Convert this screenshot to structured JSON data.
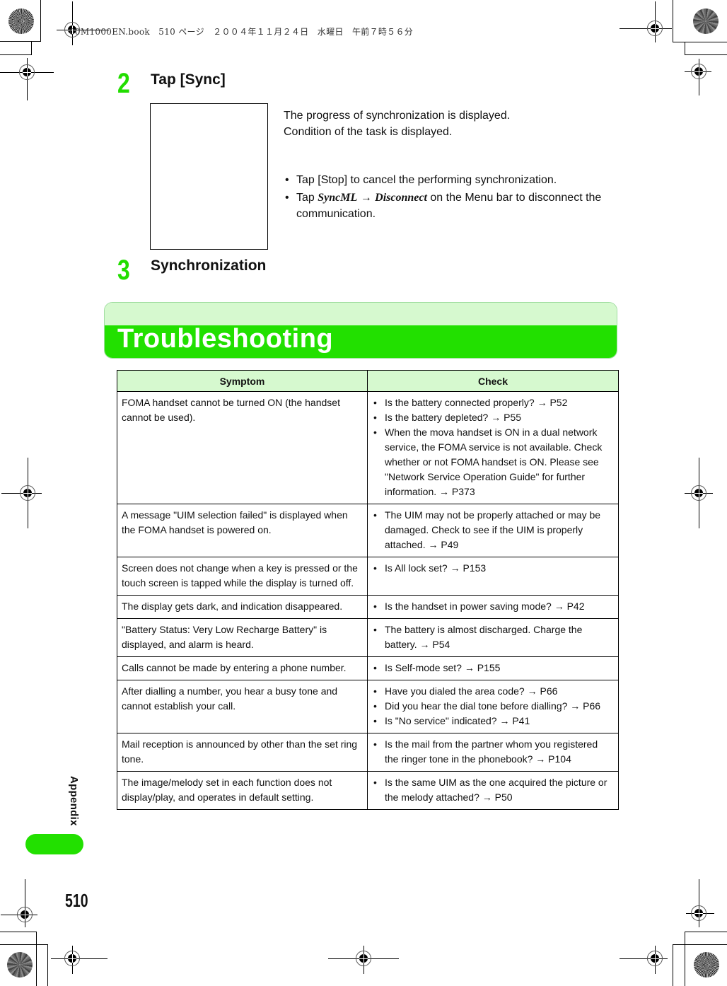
{
  "print_header": "00M1000EN.book　510 ページ　２００４年１１月２４日　水曜日　午前７時５６分",
  "steps": [
    {
      "number": "2",
      "title": "Tap [Sync]",
      "description": [
        "The progress of synchronization is displayed.",
        "Condition of the task is displayed."
      ],
      "bullets": [
        {
          "text": "Tap [Stop] to cancel the performing synchronization."
        },
        {
          "prefix": "Tap ",
          "menu1": "SyncML",
          "arrow": "→",
          "menu2": "Disconnect",
          "suffix": " on the Menu bar to disconnect the communication."
        }
      ]
    },
    {
      "number": "3",
      "title": "Synchronization"
    }
  ],
  "section": {
    "title": "Troubleshooting"
  },
  "table": {
    "headers": [
      "Symptom",
      "Check"
    ],
    "rows": [
      {
        "symptom": "FOMA handset cannot be turned ON (the handset cannot be used).",
        "checks": [
          "Is the battery connected properly? → P52",
          "Is the battery depleted? → P55",
          "When the mova handset is ON in a dual network service, the FOMA service is not available. Check whether or not FOMA handset is ON. Please see \"Network Service Operation Guide\" for further information. → P373"
        ]
      },
      {
        "symptom": "A message \"UIM selection failed\" is displayed when the FOMA handset is powered on.",
        "checks": [
          "The UIM may not be properly attached or may be damaged. Check to see if the UIM is properly attached. → P49"
        ]
      },
      {
        "symptom": "Screen does not change when a key is pressed or the touch screen is tapped while the display is turned off.",
        "checks": [
          "Is All lock set? → P153"
        ]
      },
      {
        "symptom": "The display gets dark, and indication disappeared.",
        "checks": [
          "Is the handset in power saving mode? → P42"
        ]
      },
      {
        "symptom": "\"Battery Status: Very Low Recharge Battery\" is displayed, and alarm is heard.",
        "checks": [
          "The battery is almost discharged. Charge the battery. → P54"
        ]
      },
      {
        "symptom": "Calls cannot be made by entering a phone number.",
        "checks": [
          "Is Self-mode set? → P155"
        ]
      },
      {
        "symptom": "After dialling a number, you hear a busy tone and cannot establish your call.",
        "checks": [
          "Have you dialed the area code? → P66",
          "Did you hear the dial tone before dialling? → P66",
          "Is \"No service\" indicated? → P41"
        ]
      },
      {
        "symptom": "Mail reception is announced by other than the set ring tone.",
        "checks": [
          "Is the mail from the partner whom you registered the ringer tone in the phonebook? → P104"
        ]
      },
      {
        "symptom": "The image/melody set in each function does not display/play, and operates in default setting.",
        "checks": [
          "Is the same UIM as the one acquired the picture or the melody attached? → P50"
        ]
      }
    ]
  },
  "side_tab": {
    "label": "Appendix"
  },
  "page_number": "510",
  "colors": {
    "accent_green": "#22e000",
    "light_green": "#d6f9cf"
  }
}
